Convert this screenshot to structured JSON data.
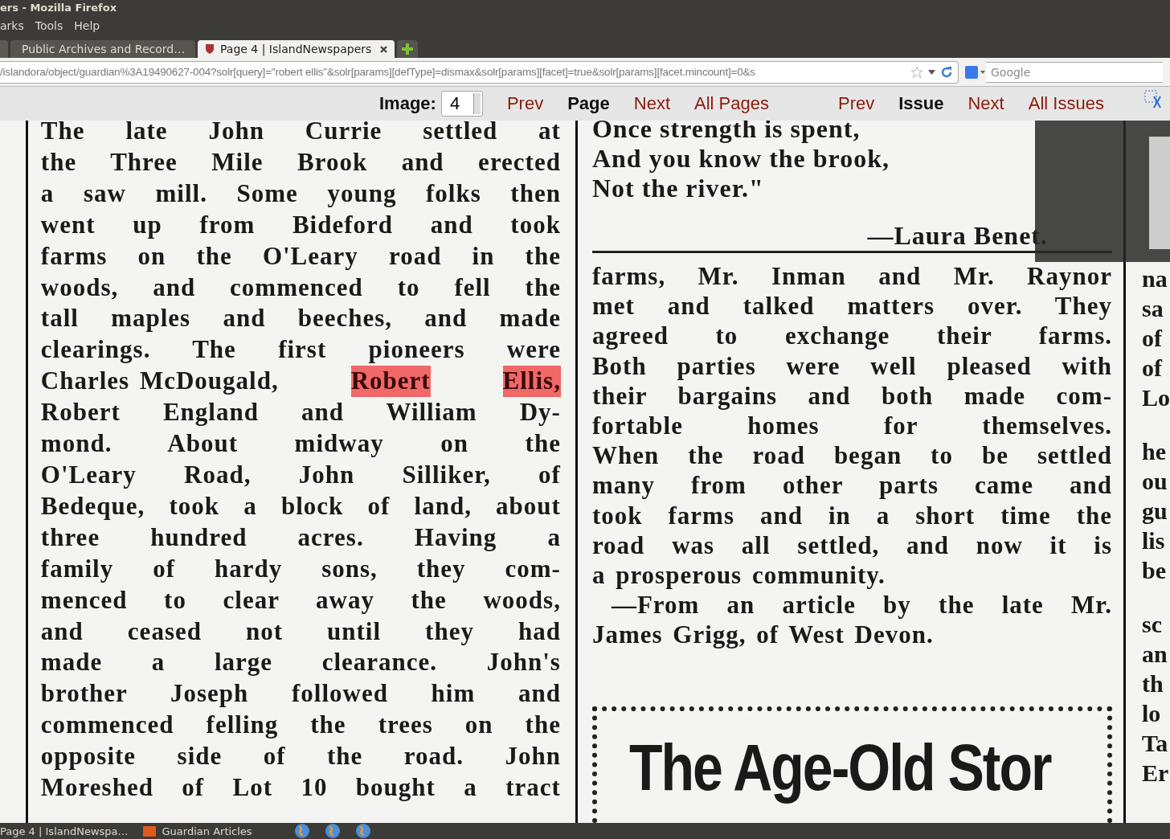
{
  "window": {
    "title": "ers - Mozilla Firefox"
  },
  "menu": [
    "arks",
    "Tools",
    "Help"
  ],
  "tabs": [
    {
      "label": "Public Archives and Record…",
      "selected": false
    },
    {
      "label": "Page 4 | IslandNewspapers",
      "selected": true
    }
  ],
  "url": "/islandora/object/guardian%3A19490627-004?solr[query]=\"robert ellis\"&solr[params][defType]=dismax&solr[params][facet]=true&solr[params][facet.mincount]=0&s",
  "search": {
    "placeholder": "Google"
  },
  "viewer": {
    "image_label": "Image:",
    "image_value": "4",
    "links": [
      {
        "label": "Prev",
        "kind": "link"
      },
      {
        "label": "Page",
        "kind": "heading"
      },
      {
        "label": "Next",
        "kind": "link"
      },
      {
        "label": "All Pages",
        "kind": "link"
      },
      {
        "label": "Prev",
        "kind": "link"
      },
      {
        "label": "Issue",
        "kind": "heading"
      },
      {
        "label": "Next",
        "kind": "link"
      },
      {
        "label": "All Issues",
        "kind": "link"
      }
    ]
  },
  "scan": {
    "left_column": [
      {
        "text": "The late John Currie settled at"
      },
      {
        "text": "the Three Mile Brook and erected"
      },
      {
        "text": "a saw mill. Some young folks then"
      },
      {
        "text": "went up from Bideford and took"
      },
      {
        "text": "farms on the O'Leary road in the"
      },
      {
        "text": "woods, and commenced to fell the"
      },
      {
        "text": "tall maples and beeches, and made"
      },
      {
        "text": "clearings. The first pioneers were"
      },
      {
        "parts": [
          {
            "text": "Charles McDougald,",
            "highlight": false
          },
          {
            "text": "Robert",
            "highlight": true
          },
          {
            "text": "Ellis,",
            "highlight": true
          }
        ]
      },
      {
        "text": "Robert England and William Dy-"
      },
      {
        "text": "mond. About midway on the"
      },
      {
        "text": "O'Leary Road, John Silliker, of"
      },
      {
        "text": "Bedeque, took a block of land, about"
      },
      {
        "text": "three hundred acres. Having a"
      },
      {
        "text": "family of hardy sons, they com-"
      },
      {
        "text": "menced to clear away the woods,"
      },
      {
        "text": "and ceased not until they had"
      },
      {
        "text": "made a large clearance. John's"
      },
      {
        "text": "brother Joseph followed him and"
      },
      {
        "text": "commenced felling the trees on the"
      },
      {
        "text": "opposite side of the road. John"
      },
      {
        "text": "Moreshed of Lot 10 bought a tract"
      }
    ],
    "poem": [
      "Once strength is spent,",
      "And you know the brook,",
      "Not the river.\""
    ],
    "poem_author": "—Laura Benet.",
    "middle_column": [
      "farms, Mr. Inman and Mr. Raynor",
      "met and talked matters over. They",
      "agreed to exchange their farms.",
      "Both parties were well pleased with",
      "their bargains and both made com-",
      "fortable homes for themselves.",
      "When the road began to be settled",
      "many from other parts came and",
      "took farms and in a short time the",
      "road was all settled, and now it is"
    ],
    "middle_last": "a prosperous community.",
    "source": [
      "—From an article by the late Mr.",
      "James Grigg, of West Devon."
    ],
    "ad_headline": "The Age-Old Stor",
    "right_fragments": [
      [
        "na",
        "sa",
        "of",
        "of",
        "Lo"
      ],
      [
        "he",
        "ou",
        "gu",
        "lis",
        "be"
      ],
      [
        "sc",
        "an",
        "th",
        "lo",
        "Ta",
        "Er"
      ]
    ]
  },
  "status_bar": {
    "task": "Page 4 | IslandNewspa…",
    "folder": "Guardian Articles"
  }
}
